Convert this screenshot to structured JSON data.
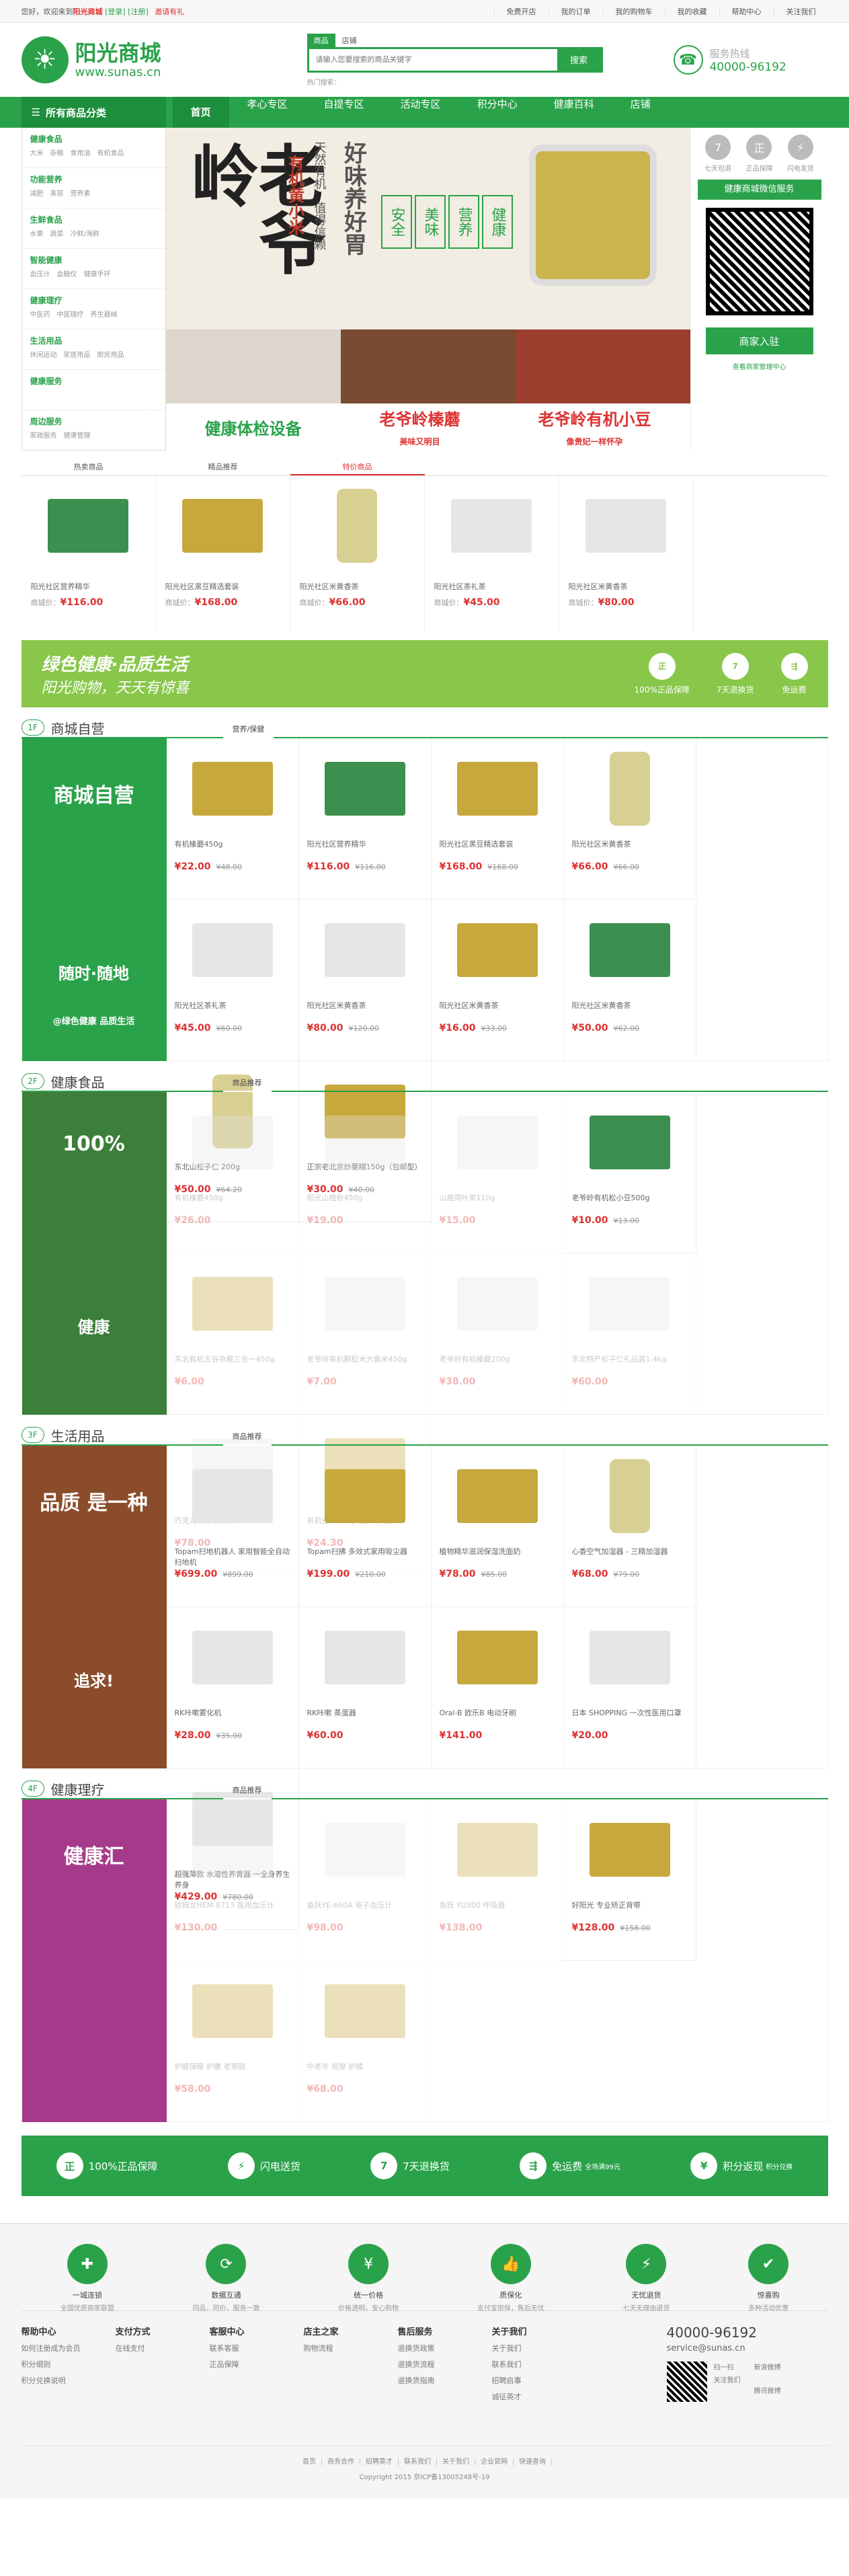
{
  "topbar": {
    "welcome": "您好，欢迎来到",
    "site": "阳光商城",
    "login": "[登录]",
    "reg": "[注册]",
    "invite": "邀请有礼",
    "links": [
      "免费开店",
      "我的订单",
      "我的购物车",
      "我的收藏",
      "帮助中心",
      "关注我们"
    ]
  },
  "header": {
    "logo_cn": "阳光商城",
    "logo_url": "www.sunas.cn",
    "search_tabs": [
      "商品",
      "店铺"
    ],
    "search_placeholder": "请输入您要搜索的商品关键字",
    "search_btn": "搜索",
    "hot_label": "热门搜索：",
    "hotline_label": "服务热线",
    "hotline_num": "40000-96192"
  },
  "nav": {
    "all": "所有商品分类",
    "items": [
      "首页",
      "孝心专区",
      "自提专区",
      "活动专区",
      "积分中心",
      "健康百科",
      "店铺"
    ]
  },
  "cats": [
    {
      "h": "健康食品",
      "s": "大米　杂粮　食用油　有机食品"
    },
    {
      "h": "功能营养",
      "s": "减肥　美容　营养素"
    },
    {
      "h": "生鲜食品",
      "s": "水果　蔬菜　冷鲜/海鲜"
    },
    {
      "h": "智能健康",
      "s": "血压计　血糖仪　健康手环"
    },
    {
      "h": "健康理疗",
      "s": "中医药　中医理疗　养生器械"
    },
    {
      "h": "生活用品",
      "s": "休闲运动　家居用品　厨房用品"
    },
    {
      "h": "健康服务",
      "s": ""
    },
    {
      "h": "周边服务",
      "s": "家政服务　健康管理"
    }
  ],
  "banner": {
    "big": "老爷岭",
    "sub1": "好味养好胃",
    "sub2": "天然有机　值得信赖",
    "tags": [
      "健康",
      "营养",
      "美味",
      "安全"
    ],
    "brand": "有机黄小米",
    "b1": "健康体检设备",
    "b2": "老爷岭榛蘑",
    "b2s": "美味又明目",
    "b3": "老爷岭有机小豆",
    "b3s": "像贵妃一样怀孕"
  },
  "right": {
    "badges": [
      "七天包退",
      "正品保障",
      "闪电发货"
    ],
    "qr_title": "健康商城微信服务",
    "biz_btn": "商家入驻",
    "biz_sub": "查看商家管理中心"
  },
  "tabs3": [
    "热卖商品",
    "精品推荐",
    "特价商品"
  ],
  "hot": [
    {
      "n": "阳光社区营养精华",
      "p": "¥116.00",
      "box": ""
    },
    {
      "n": "阳光社区黑豆精选套装",
      "p": "¥168.00",
      "box": "y"
    },
    {
      "n": "阳光社区米黄香茶",
      "p": "¥66.00",
      "box": "c"
    },
    {
      "n": "阳光社区茶礼茶",
      "p": "¥45.00",
      "box": "w"
    },
    {
      "n": "阳光社区米黄香茶",
      "p": "¥80.00",
      "box": "w"
    }
  ],
  "price_label": "商城价：",
  "promo": {
    "t1": "绿色健康·品质生活",
    "t2": "阳光购物，天天有惊喜",
    "icons": [
      {
        "i": "正",
        "t": "100%正品保障"
      },
      {
        "i": "7",
        "t": "7天退换货"
      },
      {
        "i": "⇶",
        "t": "免运费"
      }
    ]
  },
  "floors": [
    {
      "num": "1F",
      "title": "商城自营",
      "tab": "营养/保健",
      "bg": "#2aa24a",
      "big": "商城自营",
      "small": "随时·随地",
      "tag": "@绿色健康 品质生活",
      "faded": false,
      "items": [
        {
          "n": "有机榛蘑450g",
          "p": "¥22.00",
          "o": "¥48.00",
          "box": "y"
        },
        {
          "n": "阳光社区营养精华",
          "p": "¥116.00",
          "o": "¥116.00",
          "box": ""
        },
        {
          "n": "阳光社区黑豆精选套装",
          "p": "¥168.00",
          "o": "¥168.00",
          "box": "y"
        },
        {
          "n": "阳光社区米黄香茶",
          "p": "¥66.00",
          "o": "¥66.00",
          "box": "c"
        },
        {
          "n": "阳光社区茶礼茶",
          "p": "¥45.00",
          "o": "¥60.00",
          "box": "w"
        },
        {
          "n": "阳光社区米黄香茶",
          "p": "¥80.00",
          "o": "¥120.00",
          "box": "w"
        },
        {
          "n": "阳光社区米黄香茶",
          "p": "¥16.00",
          "o": "¥33.00",
          "box": "y"
        },
        {
          "n": "阳光社区米黄香茶",
          "p": "¥50.00",
          "o": "¥62.00",
          "box": ""
        },
        {
          "n": "东北山松子仁 200g",
          "p": "¥50.00",
          "o": "¥64.20",
          "box": "c"
        },
        {
          "n": "正宗老北京炒栗糊150g（包邮型）",
          "p": "¥30.00",
          "o": "¥40.00",
          "box": "y"
        }
      ]
    },
    {
      "num": "2F",
      "title": "健康食品",
      "tab": "商品推荐",
      "bg": "#3c7f3a",
      "big": "100%",
      "small": "健康",
      "tag": "",
      "faded": true,
      "items": [
        {
          "n": "有机榛蘑450g",
          "p": "¥26.00",
          "o": "",
          "box": "w"
        },
        {
          "n": "阳光山楂粉450g",
          "p": "¥19.00",
          "o": "",
          "box": "w"
        },
        {
          "n": "山楂荷叶茶110g",
          "p": "¥15.00",
          "o": "",
          "box": "w"
        },
        {
          "n": "老爷岭有机松小豆500g",
          "p": "¥10.00",
          "o": "¥13.00",
          "box": ""
        },
        {
          "n": "东北有机五谷杂粮三合一450g",
          "p": "¥6.00",
          "o": "",
          "box": "y"
        },
        {
          "n": "老爷岭有机颗粒米大黄米450g",
          "p": "¥7.00",
          "o": "",
          "box": "w"
        },
        {
          "n": "老爷岭有机榛蘑200g",
          "p": "¥38.00",
          "o": "",
          "box": "w"
        },
        {
          "n": "东北特产松子仁礼品装1.4kg",
          "p": "¥60.00",
          "o": "",
          "box": "w"
        },
        {
          "n": "巧克力牛奶 鲜奶味500ML",
          "p": "¥78.00",
          "o": "",
          "box": "w"
        },
        {
          "n": "有机白米500g 山药 新 品 ",
          "p": "¥24.30",
          "o": "",
          "box": "y"
        }
      ]
    },
    {
      "num": "3F",
      "title": "生活用品",
      "tab": "商品推荐",
      "bg": "#8b4c2b",
      "big": "品质 是一种",
      "small": "追求!",
      "tag": "",
      "faded": false,
      "items": [
        {
          "n": "Topam扫地机器人 家用智能全自动扫地机",
          "p": "¥699.00",
          "o": "¥899.00",
          "box": "w"
        },
        {
          "n": "Topam扫拂 多效式家用吸尘器",
          "p": "¥199.00",
          "o": "¥210.00",
          "box": "y"
        },
        {
          "n": "植物精华滋润保湿洗面奶",
          "p": "¥78.00",
          "o": "¥85.00",
          "box": "y"
        },
        {
          "n": "心香空气加湿器 - 三精加湿器",
          "p": "¥68.00",
          "o": "¥79.00",
          "box": "c"
        },
        {
          "n": "RK咔嗽雾化机",
          "p": "¥28.00",
          "o": "¥35.00",
          "box": "w"
        },
        {
          "n": "RK咔嗽 蒸蛋器",
          "p": "¥60.00",
          "o": "",
          "box": "w"
        },
        {
          "n": "Oral-B 欧乐B 电动牙刷",
          "p": "¥141.00",
          "o": "",
          "box": "y"
        },
        {
          "n": "日本 SHOPPING 一次性医用口罩",
          "p": "¥20.00",
          "o": "",
          "box": "w"
        },
        {
          "n": "超强薄款 水溶性养胃器 一全身养生养身",
          "p": "¥429.00",
          "o": "¥780.00",
          "box": "w"
        }
      ]
    },
    {
      "num": "4F",
      "title": "健康理疗",
      "tab": "商品推荐",
      "bg": "#a63a8a",
      "big": "健康汇",
      "small": "",
      "tag": "",
      "faded": true,
      "items": [
        {
          "n": "欧姆龙HEM-8713 医用血压计",
          "p": "¥130.00",
          "o": "",
          "box": "w"
        },
        {
          "n": "鱼跃YE-660A 电子血压计",
          "p": "¥98.00",
          "o": "",
          "box": "w"
        },
        {
          "n": "鱼跃 YU300 呼吸器",
          "p": "¥138.00",
          "o": "",
          "box": "y"
        },
        {
          "n": "好阳光 专业矫正背带",
          "p": "¥128.00",
          "o": "¥158.00",
          "box": "y"
        },
        {
          "n": "护膝保暖 护腰 老寒腿",
          "p": "¥58.00",
          "o": "",
          "box": "y"
        },
        {
          "n": "中老年 按摩 护膝",
          "p": "¥68.00",
          "o": "",
          "box": "y"
        }
      ]
    }
  ],
  "bottombar": [
    {
      "i": "正",
      "t": "100%正品保障"
    },
    {
      "i": "⚡",
      "t": "闪电送货"
    },
    {
      "i": "7",
      "t": "7天退换货"
    },
    {
      "i": "⇶",
      "t": "免运费",
      "s": "全场满99元"
    },
    {
      "i": "¥",
      "t": "积分返现",
      "s": "积分兑换"
    }
  ],
  "footer": {
    "svc": [
      {
        "i": "✚",
        "l1": "一城连锁",
        "l2": "全国优质商家联盟"
      },
      {
        "i": "⟳",
        "l1": "数据互通",
        "l2": "同品，同价，服务一致"
      },
      {
        "i": "¥",
        "l1": "统一价格",
        "l2": "价格透明，安心购物"
      },
      {
        "i": "👍",
        "l1": "质保化",
        "l2": "支付宝担保，售后无忧"
      },
      {
        "i": "⚡",
        "l1": "无忧退货",
        "l2": "七天无理由退货"
      },
      {
        "i": "✔",
        "l1": "惊喜购",
        "l2": "多种活动优惠"
      }
    ],
    "cols": [
      {
        "h": "帮助中心",
        "i": [
          "如何注册成为会员",
          "积分细则",
          "积分兑换说明"
        ]
      },
      {
        "h": "支付方式",
        "i": [
          "在线支付"
        ]
      },
      {
        "h": "客服中心",
        "i": [
          "联系客服",
          "正品保障"
        ]
      },
      {
        "h": "店主之家",
        "i": [
          "购物流程"
        ]
      },
      {
        "h": "售后服务",
        "i": [
          "退换货政策",
          "退换货流程",
          "退换货指南"
        ]
      },
      {
        "h": "关于我们",
        "i": [
          "关于我们",
          "联系我们",
          "招聘启事",
          "诚征英才"
        ]
      }
    ],
    "phone": "40000-96192",
    "email": "service@sunas.cn",
    "qr1": "扫一扫",
    "qr2": "关注我们",
    "weibo1": "新浪微博",
    "weibo2": "腾讯微博",
    "bottom": [
      "首页",
      "商务合作",
      "招聘英才",
      "联系我们",
      "关于我们",
      "企业官网",
      "快速查询"
    ],
    "icp": "Copyright 2015 京ICP备13005248号-19"
  }
}
